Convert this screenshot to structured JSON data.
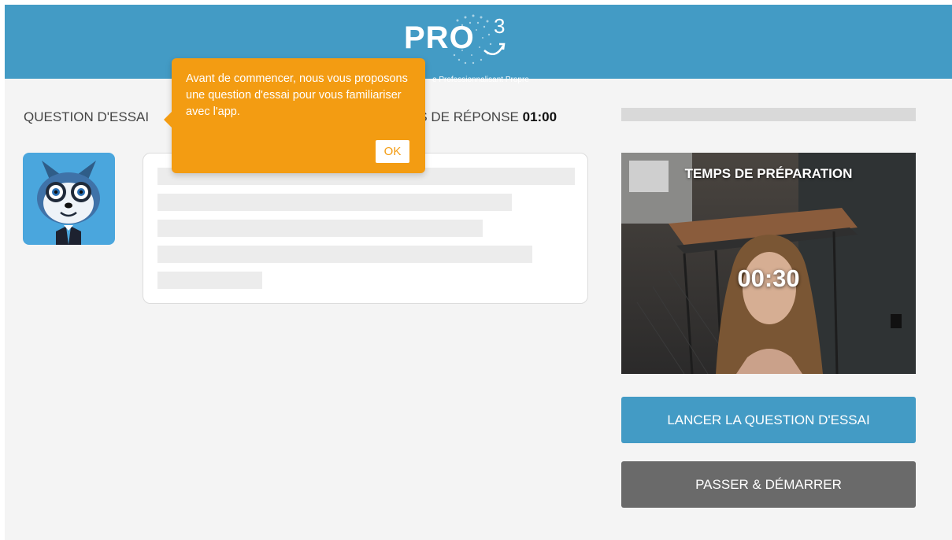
{
  "header": {
    "logo_text": "PRO",
    "logo_superscript": "3",
    "logo_tagline": "e Professionnalisant Propre",
    "colors": {
      "background": "#439bc5"
    }
  },
  "question": {
    "label": "QUESTION D'ESSAI",
    "time_label": "PS DE RÉPONSE",
    "time_value": "01:00"
  },
  "video": {
    "title": "TEMPS DE PRÉPARATION",
    "timer": "00:30"
  },
  "buttons": {
    "start_trial": "LANCER LA QUESTION D'ESSAI",
    "skip_start": "PASSER & DÉMARRER"
  },
  "tooltip": {
    "text": "Avant de commencer, nous vous proposons une question d'essai pour vous familiariser avec l'app.",
    "ok": "OK",
    "colors": {
      "background": "#f39c12"
    }
  },
  "icons": {
    "avatar": "meerkat-mascot-icon"
  }
}
